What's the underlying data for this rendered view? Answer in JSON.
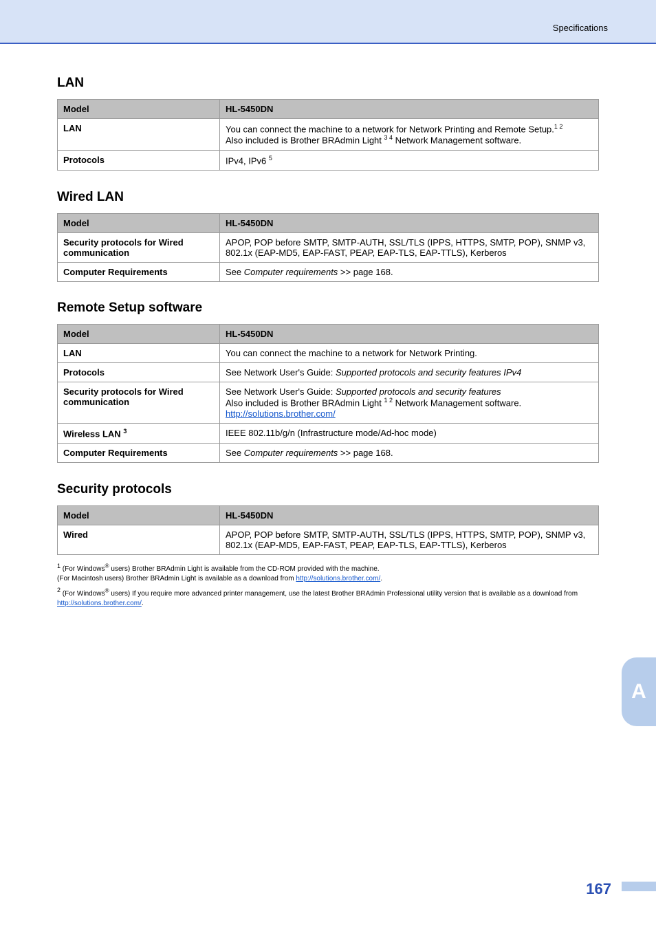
{
  "header": {
    "title": "Specifications"
  },
  "sections": [
    {
      "heading": "LAN",
      "columnHeaders": [
        "Model",
        "HL-5450DN"
      ],
      "rows": [
        {
          "label_html": "LAN",
          "value_html": "You can connect the machine to a network for Network Printing and Remote Setup.<span class='sup'>1 2</span><br>Also included is Brother BRAdmin Light <span class='sup'>3 4</span> Network Management software."
        },
        {
          "label_html": "Protocols",
          "value_html": "IPv4, IPv6 <span class='sup'>5</span>"
        }
      ]
    },
    {
      "heading": "Wired LAN",
      "columnHeaders": [
        "Model",
        "HL-5450DN"
      ],
      "rows": [
        {
          "label_html": "Security protocols for Wired communication",
          "value_html": "APOP, POP before SMTP, SMTP-AUTH, SSL/TLS (IPPS, HTTPS, SMTP, POP), SNMP v3, 802.1x (EAP-MD5, EAP-FAST, PEAP, EAP-TLS, EAP-TTLS), Kerberos"
        },
        {
          "label_html": "Computer Requirements",
          "value_html": "See <i>Computer requirements</i> &gt;&gt; page 168."
        }
      ],
      "footnotes": [
        {
          "num": "1",
          "text": "(For Windows<sup>®</sup> users) Brother BRAdmin Light is available from the CD-ROM provided with the machine.<br>(For Macintosh users) Brother BRAdmin Light is available as a download from <a class='link' data-name='footnote-link' data-interactable='true'>http://solutions.brother.com/</a>."
        },
        {
          "num": "2",
          "text": "(For Windows<sup>®</sup> users) If you require more advanced printer management, use the latest Brother BRAdmin Professional utility version that is available as a download from <a class='link' data-name='footnote-link' data-interactable='true'>http://solutions.brother.com/</a>."
        }
      ]
    },
    {
      "heading": "Remote Setup software",
      "columnHeaders": [
        "Model",
        "HL-5450DN"
      ],
      "rows": [
        {
          "label_html": "LAN",
          "value_html": "You can connect the machine to a network for Network Printing."
        },
        {
          "label_html": "Protocols",
          "value_html": "See Network User's Guide: <i>Supported protocols and security features IPv4</i>"
        },
        {
          "label_html": "Security protocols for Wired communication",
          "value_html": "See Network User's Guide: <i>Supported protocols and security features</i><br>Also included is Brother BRAdmin Light <span class='sup'>1 2</span> Network Management software.<br><a class='link' data-name='link' data-interactable='true'>http://solutions.brother.com/</a>"
        },
        {
          "label_html": "Wireless LAN <span class='sup'>3</span>",
          "value_html": "IEEE 802.11b/g/n (Infrastructure mode/Ad-hoc mode)"
        },
        {
          "label_html": "Computer Requirements",
          "value_html": "See <i>Computer requirements</i> &gt;&gt; page 168."
        }
      ]
    },
    {
      "heading": "Security protocols",
      "columnHeaders": [
        "Model",
        "HL-5450DN"
      ],
      "rows": [
        {
          "label_html": "Wired",
          "value_html": "APOP, POP before SMTP, SMTP-AUTH, SSL/TLS (IPPS, HTTPS, SMTP, POP), SNMP v3, 802.1x (EAP-MD5, EAP-FAST, PEAP, EAP-TLS, EAP-TTLS), Kerberos"
        }
      ],
      "footnotes": [
        {
          "num": "1",
          "text": "(For Windows<sup>®</sup> users) Brother BRAdmin Light is available from the CD-ROM provided with the machine.<br>(For Macintosh users) Brother BRAdmin Light is available as a download from <a class='link' data-name='footnote-link' data-interactable='true'>http://solutions.brother.com/</a>."
        },
        {
          "num": "2",
          "text": "(For Windows<sup>®</sup> users) If you require more advanced printer management, use the latest Brother BRAdmin Professional utility version that is available as a download from <a class='link' data-name='footnote-link' data-interactable='true'>http://solutions.brother.com/</a>."
        }
      ]
    }
  ],
  "sidetab": {
    "label": "A"
  },
  "footer": {
    "page": "167"
  }
}
